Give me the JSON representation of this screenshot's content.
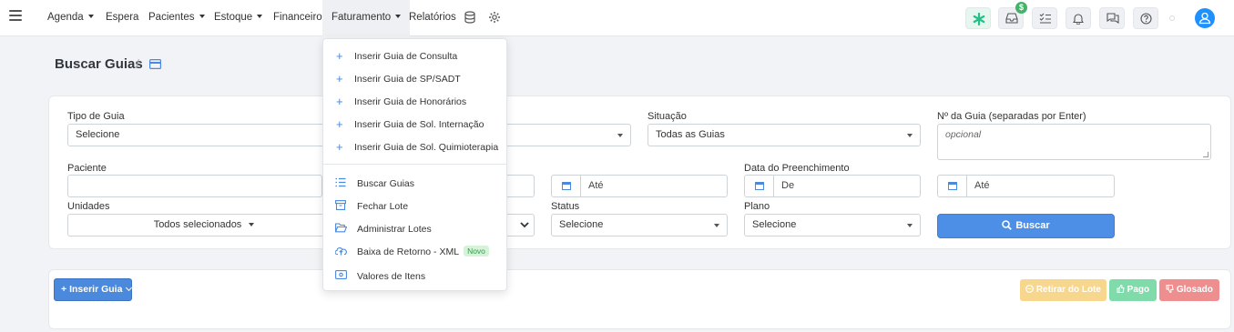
{
  "nav": {
    "items": [
      {
        "label": "Agenda",
        "caret": true
      },
      {
        "label": "Espera",
        "caret": false
      },
      {
        "label": "Pacientes",
        "caret": true
      },
      {
        "label": "Estoque",
        "caret": true
      },
      {
        "label": "Financeiro",
        "caret": false
      },
      {
        "label": "Faturamento",
        "caret": true
      },
      {
        "label": "Relatórios",
        "caret": false
      }
    ],
    "money_badge": "$"
  },
  "page": {
    "title": "Buscar Guias",
    "separator": "/"
  },
  "filters": {
    "tipo_guia": {
      "label": "Tipo de Guia",
      "value": "Selecione"
    },
    "situacao": {
      "label": "Situação",
      "value": "Todas as Guias"
    },
    "numero_guia": {
      "label": "Nº da Guia (separadas por Enter)",
      "placeholder": "opcional"
    },
    "paciente": {
      "label": "Paciente",
      "value": ""
    },
    "ate_1": {
      "value": "Até"
    },
    "data_preenchimento": {
      "label": "Data do Preenchimento",
      "de": "De",
      "ate": "Até"
    },
    "unidades": {
      "label": "Unidades",
      "value": "Todos selecionados"
    },
    "status": {
      "label": "Status",
      "value": "Selecione"
    },
    "plano": {
      "label": "Plano",
      "value": "Selecione"
    },
    "buscar_label": "Buscar"
  },
  "actions": {
    "inserir_guia": "Inserir Guia",
    "retirar_lote": "Retirar do Lote",
    "pago": "Pago",
    "glosado": "Glosado"
  },
  "dropdown": {
    "insert_items": [
      "Inserir Guia de Consulta",
      "Inserir Guia de SP/SADT",
      "Inserir Guia de Honorários",
      "Inserir Guia de Sol. Internação",
      "Inserir Guia de Sol. Quimioterapia"
    ],
    "other_items": [
      {
        "label": "Buscar Guias",
        "icon": "list-icon"
      },
      {
        "label": "Fechar Lote",
        "icon": "archive-icon"
      },
      {
        "label": "Administrar Lotes",
        "icon": "folder-open-icon"
      },
      {
        "label": "Baixa de Retorno - XML",
        "icon": "cloud-upload-icon",
        "badge": "Novo"
      },
      {
        "label": "Valores de Itens",
        "icon": "money-bill-icon"
      }
    ]
  },
  "colors": {
    "primary": "#4d8fe6",
    "retirar": "#f7d68d",
    "pago": "#7fdcaa",
    "glosado": "#ef8e8e",
    "avatar": "#1e90ff"
  }
}
